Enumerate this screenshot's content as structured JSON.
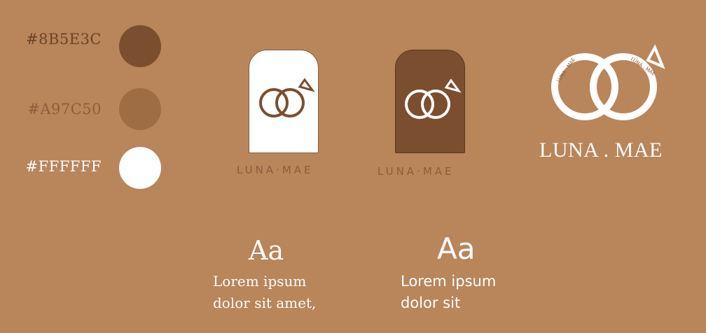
{
  "palette": {
    "colors": [
      {
        "hex": "#8B5E3C",
        "label": "#8B5E3C",
        "label_color": "#6B4428"
      },
      {
        "hex": "#A97C50",
        "label": "#A97C50",
        "label_color": "#8B5E3C"
      },
      {
        "hex": "#FFFFFF",
        "label": "#FFFFFF",
        "label_color": "#FFFFFF"
      }
    ]
  },
  "logos": {
    "light_card": {
      "caption": "LUNA·MAE",
      "bg": "#FFFFFF",
      "ring_color": "#8B5E3C",
      "caption_color": "#8B5E3C"
    },
    "dark_card": {
      "caption": "LUNA·MAE",
      "bg": "#8B5E3C",
      "ring_color": "#FFFFFF",
      "caption_color": "#8B5E3C"
    },
    "large": {
      "name": "LUNA . MAE",
      "ring_text_left": "LUNA . MAE",
      "ring_text_right": "LUNA . MAE",
      "color": "#FFFFFF"
    }
  },
  "typography": {
    "serif": {
      "glyph": "Aa",
      "sample_line1": "Lorem ipsum",
      "sample_line2": "dolor sit amet,"
    },
    "sans": {
      "glyph": "Aa",
      "sample_line1": "Lorem ipsum",
      "sample_line2": "dolor sit"
    }
  }
}
